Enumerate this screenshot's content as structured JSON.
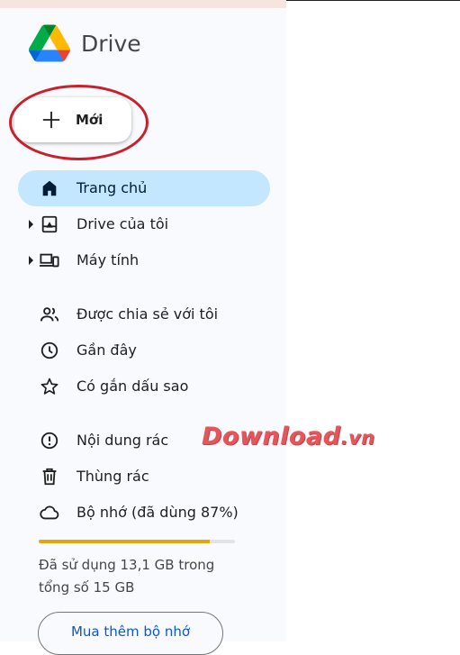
{
  "brand": {
    "name": "Drive",
    "logo_icon": "google-drive-logo"
  },
  "new_button": {
    "label": "Mới",
    "icon": "plus-icon"
  },
  "nav": {
    "home": {
      "label": "Trang chủ",
      "icon": "home-icon",
      "active": true
    },
    "my_drive": {
      "label": "Drive của tôi",
      "icon": "my-drive-icon"
    },
    "computers": {
      "label": "Máy tính",
      "icon": "computer-icon"
    },
    "shared": {
      "label": "Được chia sẻ với tôi",
      "icon": "people-icon"
    },
    "recent": {
      "label": "Gần đây",
      "icon": "clock-icon"
    },
    "starred": {
      "label": "Có gắn dấu sao",
      "icon": "star-icon"
    },
    "spam": {
      "label": "Nội dung rác",
      "icon": "report-icon"
    },
    "trash": {
      "label": "Thùng rác",
      "icon": "trash-icon"
    },
    "storage": {
      "label": "Bộ nhớ (đã dùng 87%)",
      "icon": "cloud-icon"
    }
  },
  "storage": {
    "used_fraction": 0.87,
    "usage_line1": "Đã sử dụng 13,1 GB trong",
    "usage_line2": "tổng số 15 GB",
    "bar_color": "#e8a40b"
  },
  "buy_storage": {
    "label": "Mua thêm bộ nhớ"
  },
  "watermark": {
    "main": "Download",
    "tld": ".vn"
  },
  "colors": {
    "active_bg": "#c2e7ff",
    "accent_blue": "#0b57d0",
    "annotation_red": "#c8212b"
  }
}
